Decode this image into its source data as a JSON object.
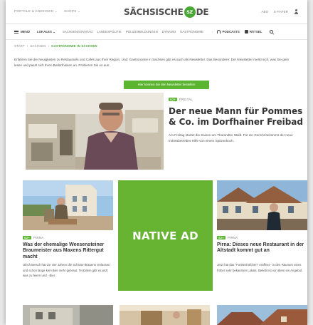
{
  "header": {
    "left_links": [
      "PORTALE & ANZEIGEN ⌄",
      "SHOPS ⌄"
    ],
    "logo_left": "SÄCHSISCHE",
    "logo_badge": "SZ",
    "logo_right": "DE",
    "abo": "ABO",
    "epaper": "E-PAPER"
  },
  "nav": {
    "menu_label": "MENÜ",
    "lokales": "LOKALES ⌄",
    "items": [
      "SACHSENSONNTAG",
      "LANDESPOLITIK",
      "POLIZEIMELDUNGEN",
      "DYNAMO",
      "GASTRONOMIE"
    ],
    "more": "›",
    "podcasts": "PODCASTS",
    "raetsel": "RÄTSEL"
  },
  "breadcrumb": [
    "START",
    "SACHSEN",
    "GASTRONOMIE IN SACHSEN"
  ],
  "intro_text": "Erfahren Sie die Neuigkeiten zu Restaurants und Cafés aus Ihrer Region. Und: Gastronomie in Sachsen gibt es auch als Newsletter. Das Besondere: Der Newsletter merkt sich, was Sie gern lesen und passt sich Ihren Bedürfnissen an. Probieren Sie es aus.",
  "newsletter_button": "Hier können Sie den Newsletter bestellen",
  "featured": {
    "badge": "SZ+",
    "tag": "FREITAL",
    "title": "Der neue Mann für Pommes & Co. im Dorfhainer Freibad",
    "text": "Am Freitag startet die Saison am Tharandter Wald. Für ein Gericht bekommt der neue Imbissbetreiber Hilfe von einem Spitzenkoch."
  },
  "cards": [
    {
      "badge": "SZ+",
      "tag": "PIRNA",
      "title": "Was der ehemalige Weesensteiner Braumeister aus Maxens Rittergut macht",
      "text": "Ulrich Betsch hat vor vier Jahren die Schloss-Brauerei verlassen und schon lange kein Bier mehr gebraut. Trotzdem gibt es jetzt was zu feiern und - Bier."
    },
    {
      "badge": "SZ+",
      "tag": "PIRNA",
      "title": "Pirna: Dieses neue Restaurant in der Altstadt kommt gut an",
      "text": "Jetzt hat das \"Funkenhöfchen\" eröffnet - in den Räumen eines früher sehr bekannten Lokals. Beliebt ist vor allem ein Angebot."
    }
  ],
  "native_ad_label": "NATIVE AD",
  "colors": {
    "brand_green": "#5cb531",
    "ad_green": "#66b432"
  }
}
